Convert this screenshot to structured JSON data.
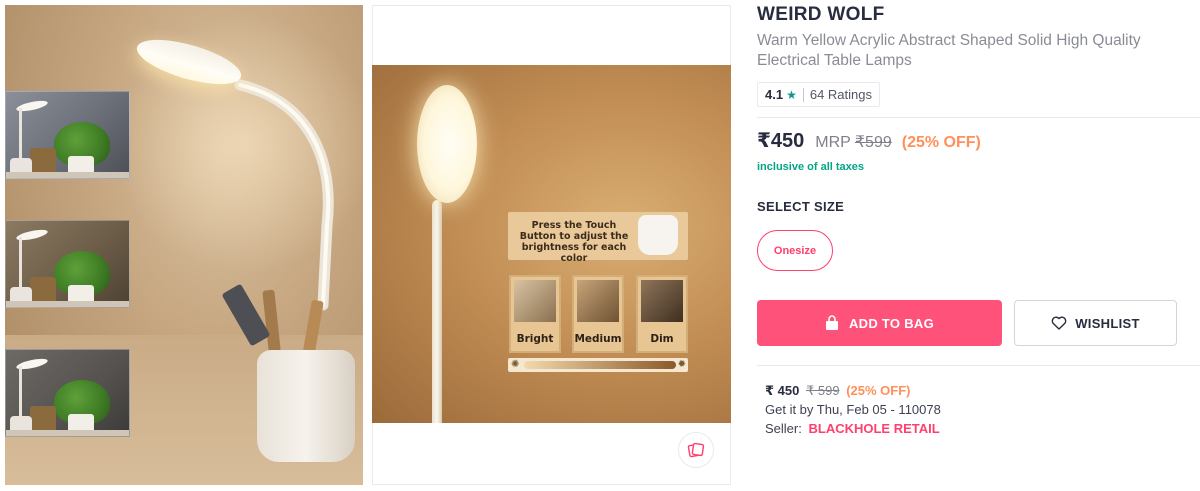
{
  "gallery": {
    "thumbnails": [
      "bright-mode",
      "medium-mode",
      "dim-mode"
    ],
    "infographic": {
      "instruction": "Press the Touch Button to adjust the brightness for each color",
      "modes": [
        "Bright",
        "Medium",
        "Dim"
      ]
    },
    "compare_icon": "compare-icon"
  },
  "product": {
    "brand": "WEIRD WOLF",
    "title": "Warm Yellow Acrylic Abstract Shaped Solid High Quality Electrical Table Lamps",
    "rating": "4.1",
    "rating_star": "★",
    "ratings_count": "64 Ratings",
    "price": "₹450",
    "mrp_label": "MRP",
    "mrp": "₹599",
    "discount": "(25% OFF)",
    "taxes_note": "inclusive of all taxes",
    "select_size_label": "SELECT SIZE",
    "sizes": [
      "Onesize"
    ]
  },
  "actions": {
    "add_to_bag": "ADD TO BAG",
    "wishlist": "WISHLIST"
  },
  "delivery": {
    "price": "₹ 450",
    "mrp": "₹ 599",
    "discount": "(25% OFF)",
    "eta": "Get it by Thu, Feb 05 - 110078",
    "seller_label": "Seller:",
    "seller_name": "BLACKHOLE RETAIL"
  },
  "colors": {
    "accent": "#ff3f6c",
    "add_to_bag_bg": "#ff527b",
    "discount": "#ff905a",
    "taxes": "#03a685",
    "rating_star": "#14958f"
  }
}
